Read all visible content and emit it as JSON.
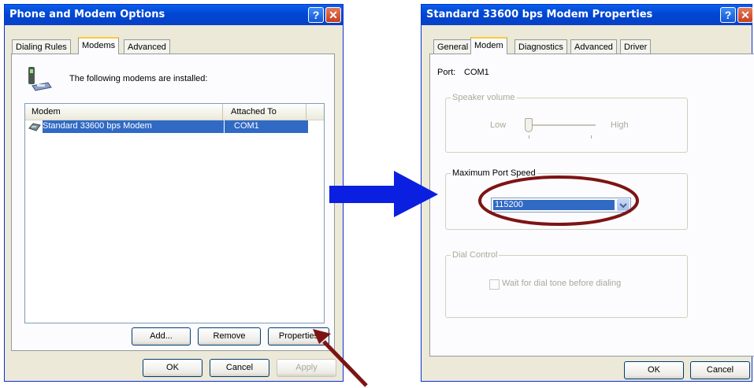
{
  "left_window": {
    "title": "Phone and Modem Options",
    "tabs": [
      "Dialing Rules",
      "Modems",
      "Advanced"
    ],
    "intro_text": "The following modems are installed:",
    "columns": [
      "Modem",
      "Attached To"
    ],
    "rows": [
      {
        "modem": "Standard 33600 bps Modem",
        "attached_to": "COM1"
      }
    ],
    "buttons": {
      "add": "Add...",
      "remove": "Remove",
      "properties": "Properties",
      "ok": "OK",
      "cancel": "Cancel",
      "apply": "Apply"
    }
  },
  "right_window": {
    "title": "Standard 33600 bps Modem Properties",
    "tabs": [
      "General",
      "Modem",
      "Diagnostics",
      "Advanced",
      "Driver"
    ],
    "port_label": "Port:",
    "port_value": "COM1",
    "speaker_volume": {
      "legend": "Speaker volume",
      "low": "Low",
      "high": "High",
      "level": 0.05
    },
    "max_port_speed": {
      "legend": "Maximum Port Speed",
      "selected": "115200"
    },
    "dial_control": {
      "legend": "Dial Control",
      "checkbox_label": "Wait for dial tone before dialing",
      "checked": false
    },
    "buttons": {
      "ok": "OK",
      "cancel": "Cancel"
    }
  },
  "colors": {
    "xp_title_blue": "#0a5fe8",
    "selection_blue": "#316ac5",
    "arrow_blue": "#0a1fe0",
    "annotation_red": "#7d1414"
  }
}
